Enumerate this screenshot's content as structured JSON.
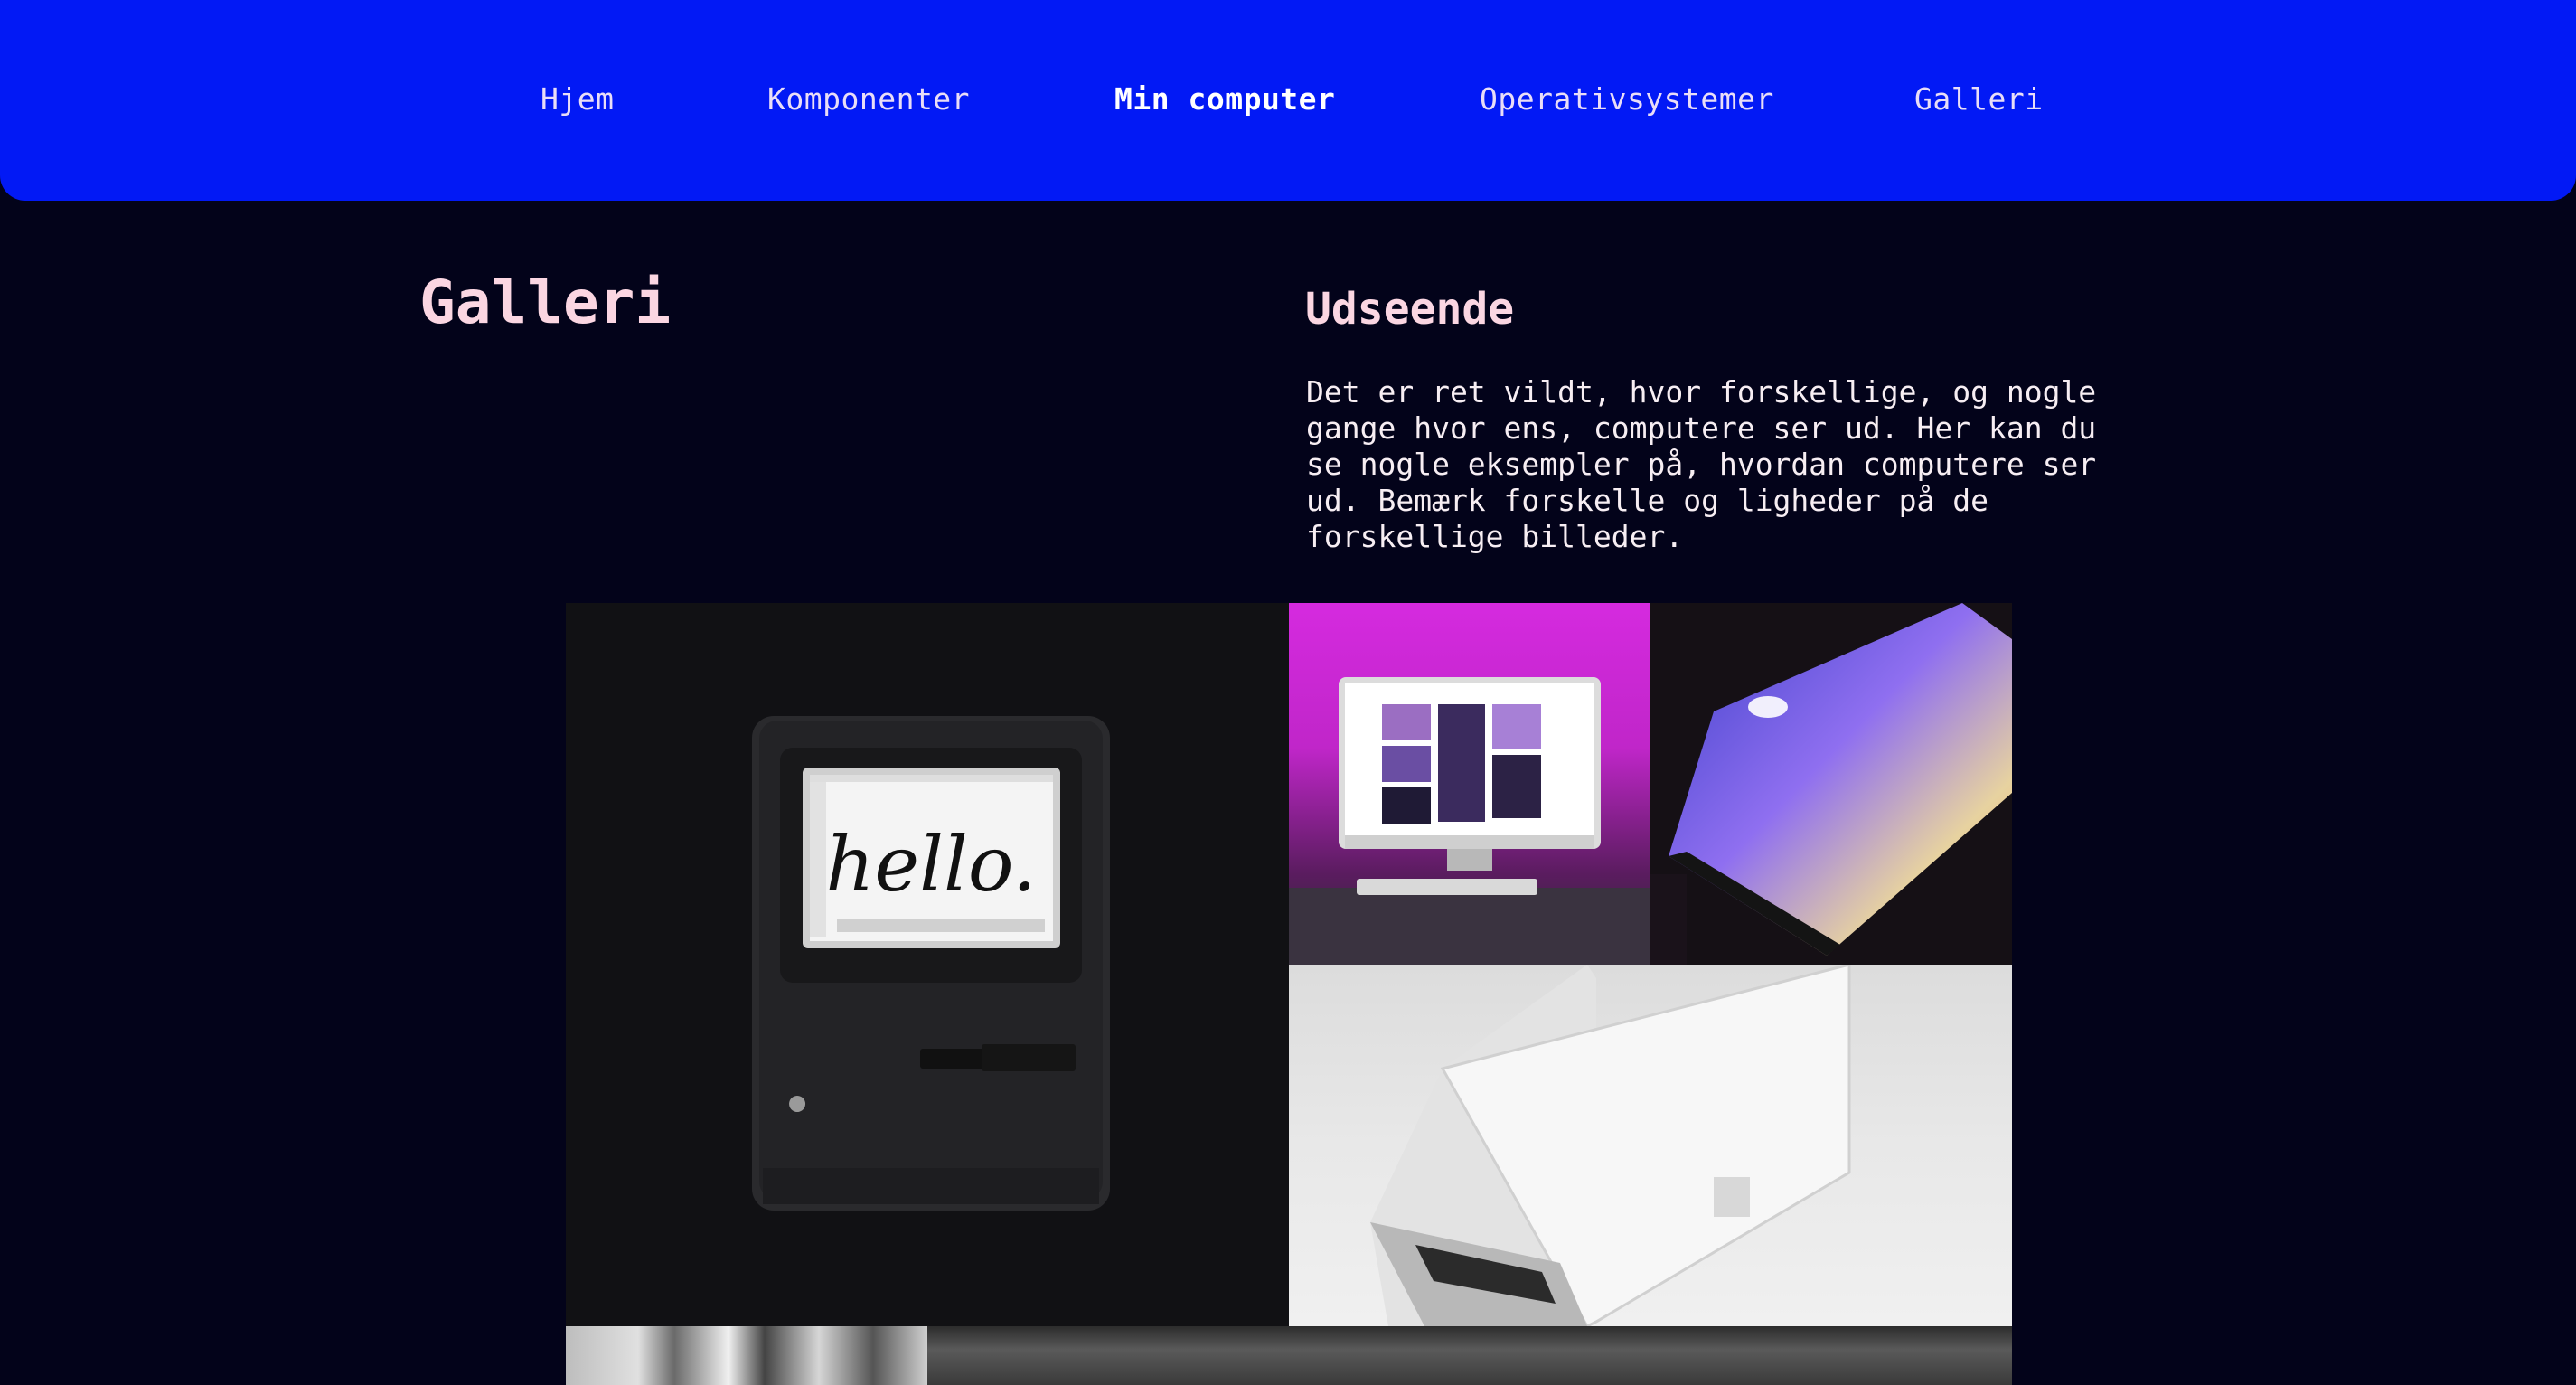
{
  "nav": {
    "items": [
      {
        "label": "Hjem"
      },
      {
        "label": "Komponenter"
      },
      {
        "label": "Min computer"
      },
      {
        "label": "Operativsystemer"
      },
      {
        "label": "Galleri"
      }
    ]
  },
  "page": {
    "title": "Galleri"
  },
  "intro": {
    "heading": "Udseende",
    "body": "Det er ret vildt, hvor forskellige, og nogle gange hvor ens, computere ser ud. Her kan du se nogle eksempler på, hvordan computere ser ud. Bemærk forskelle og ligheder på de forskellige billeder."
  },
  "gallery": {
    "mac_screen_text": "hello."
  },
  "colors": {
    "nav_background": "#0219f5",
    "page_background": "#03031a",
    "heading_color": "#fbd6e2"
  }
}
